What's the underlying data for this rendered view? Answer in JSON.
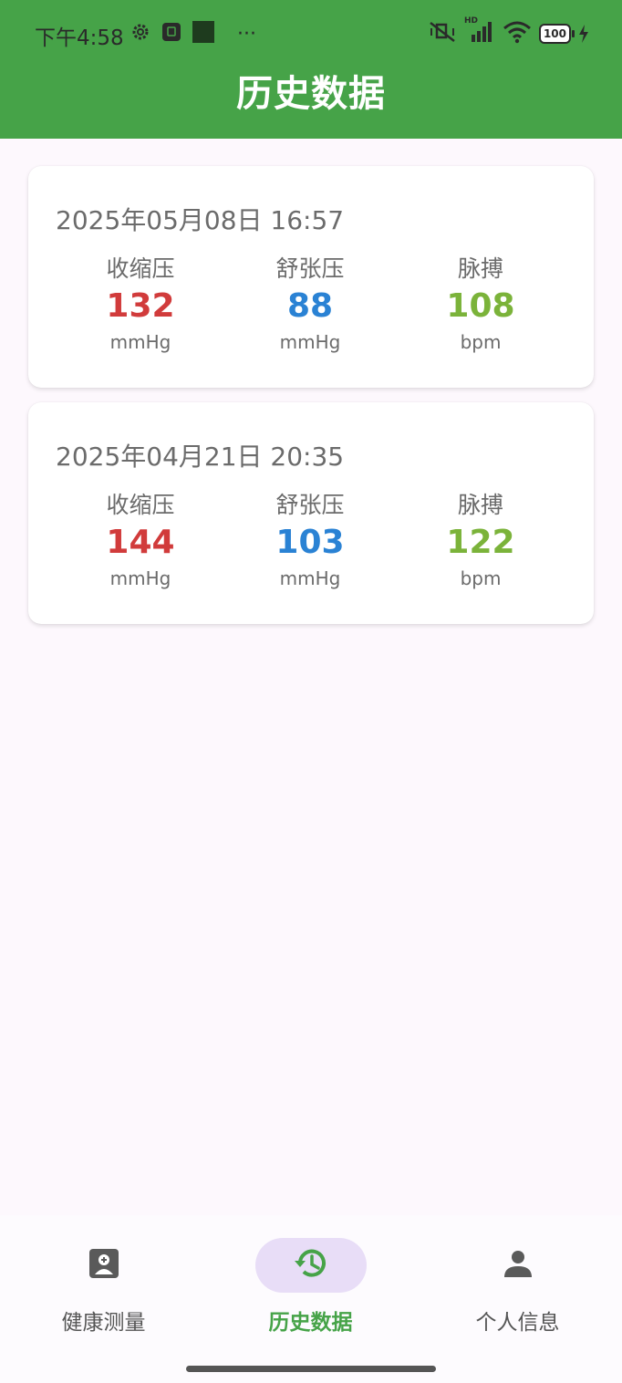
{
  "status_bar": {
    "time": "下午4:58",
    "more": "···",
    "left_icons": [
      "gear-icon",
      "sim-icon",
      "square-icon"
    ],
    "right_icons": [
      "mute-icon",
      "signal-icon",
      "wifi-icon",
      "battery-icon"
    ],
    "hd_label": "HD",
    "battery_text": "100"
  },
  "header": {
    "title": "历史数据"
  },
  "records": [
    {
      "datetime": "2025年05月08日 16:57",
      "systolic": {
        "label": "收缩压",
        "value": "132",
        "unit": "mmHg"
      },
      "diastolic": {
        "label": "舒张压",
        "value": "88",
        "unit": "mmHg"
      },
      "pulse": {
        "label": "脉搏",
        "value": "108",
        "unit": "bpm"
      }
    },
    {
      "datetime": "2025年04月21日 20:35",
      "systolic": {
        "label": "收缩压",
        "value": "144",
        "unit": "mmHg"
      },
      "diastolic": {
        "label": "舒张压",
        "value": "103",
        "unit": "mmHg"
      },
      "pulse": {
        "label": "脉搏",
        "value": "122",
        "unit": "bpm"
      }
    }
  ],
  "colors": {
    "header_bg": "#46a348",
    "systolic": "#d13b3b",
    "diastolic": "#2a82d4",
    "pulse": "#7bb33a",
    "nav_active_pill": "#e8ddf7"
  },
  "bottom_nav": {
    "items": [
      {
        "label": "健康测量",
        "icon": "health-measure-icon",
        "active": false
      },
      {
        "label": "历史数据",
        "icon": "history-icon",
        "active": true
      },
      {
        "label": "个人信息",
        "icon": "person-icon",
        "active": false
      }
    ]
  }
}
